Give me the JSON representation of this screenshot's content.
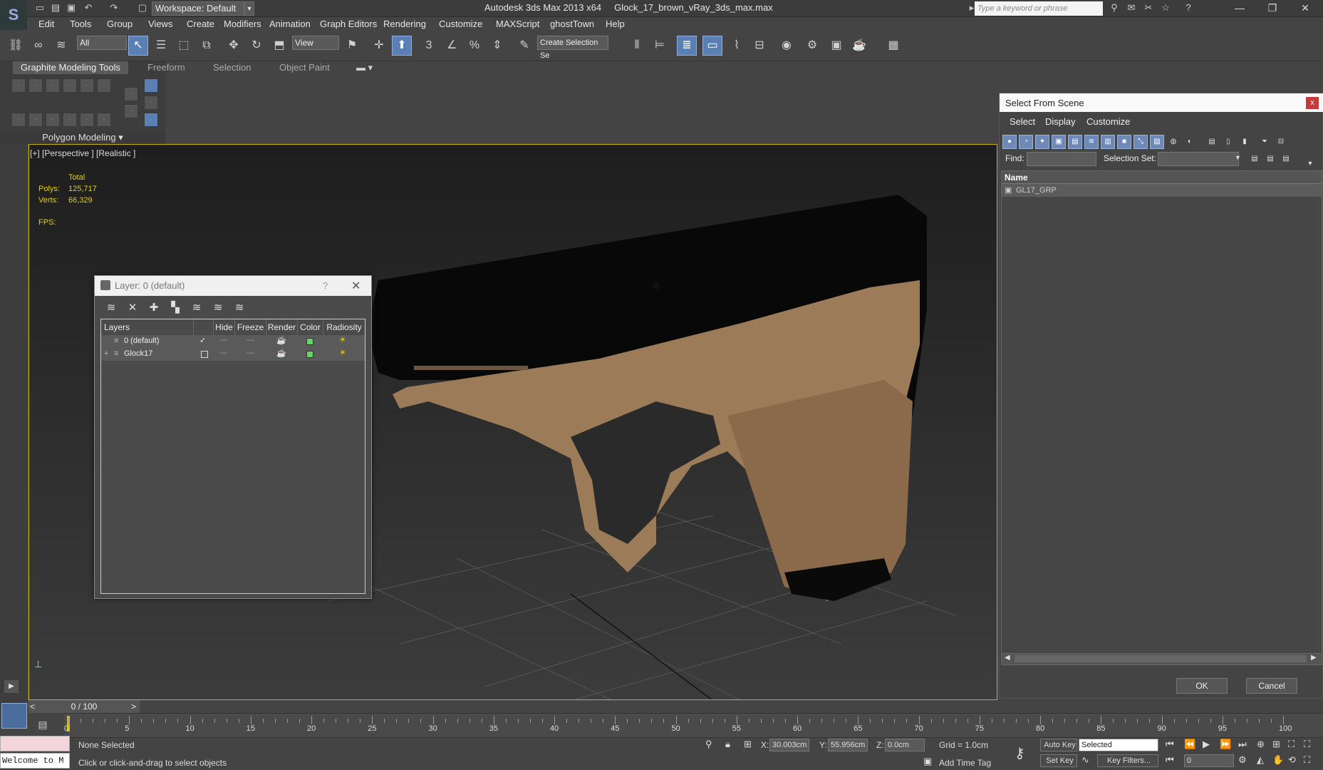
{
  "titlebar": {
    "workspace": "Workspace: Default",
    "app_name": "Autodesk 3ds Max  2013 x64",
    "file_name": "Glock_17_brown_vRay_3ds_max.max",
    "search_placeholder": "Type a keyword or phrase"
  },
  "menu": [
    "Edit",
    "Tools",
    "Group",
    "Views",
    "Create",
    "Modifiers",
    "Animation",
    "Graph Editors",
    "Rendering",
    "Customize",
    "MAXScript",
    "ghostTown",
    "Help"
  ],
  "toolbar": {
    "selection_filter": "All",
    "ref_coord": "View",
    "named_selection": "Create Selection Se"
  },
  "ribbon": {
    "tabs": [
      "Graphite Modeling Tools",
      "Freeform",
      "Selection",
      "Object Paint"
    ],
    "panel_label": "Polygon Modeling"
  },
  "viewport": {
    "label": "[+] [Perspective ] [Realistic ]",
    "stats_total": "Total",
    "polys_label": "Polys:",
    "polys_value": "125,717",
    "verts_label": "Verts:",
    "verts_value": "66,329",
    "fps_label": "FPS:"
  },
  "layer_dialog": {
    "title": "Layer: 0 (default)",
    "help": "?",
    "columns": [
      "Layers",
      "Hide",
      "Freeze",
      "Render",
      "Color",
      "Radiosity"
    ],
    "rows": [
      "0 (default)",
      "Glock17"
    ]
  },
  "select_from_scene": {
    "title": "Select From Scene",
    "menus": [
      "Select",
      "Display",
      "Customize"
    ],
    "find_label": "Find:",
    "selection_set_label": "Selection Set:",
    "column_name": "Name",
    "items": [
      "GL17_GRP"
    ],
    "ok": "OK",
    "cancel": "Cancel"
  },
  "timeline": {
    "frame": "0 / 100",
    "ticks": [
      "0",
      "5",
      "10",
      "15",
      "20",
      "25",
      "30",
      "35",
      "40",
      "45",
      "50",
      "55",
      "60",
      "65",
      "70",
      "75",
      "80",
      "85",
      "90",
      "95",
      "100"
    ]
  },
  "status": {
    "welcome": "Welcome to M",
    "selection": "None Selected",
    "prompt": "Click or click-and-drag to select objects",
    "x_label": "X:",
    "x_value": "30.003cm",
    "y_label": "Y:",
    "y_value": "55.956cm",
    "z_label": "Z:",
    "z_value": "0.0cm",
    "grid": "Grid = 1.0cm",
    "auto_key": "Auto Key",
    "key_mode": "Selected",
    "set_key": "Set Key",
    "key_filters": "Key Filters...",
    "add_time_tag": "Add Time Tag",
    "current_frame": "0"
  }
}
